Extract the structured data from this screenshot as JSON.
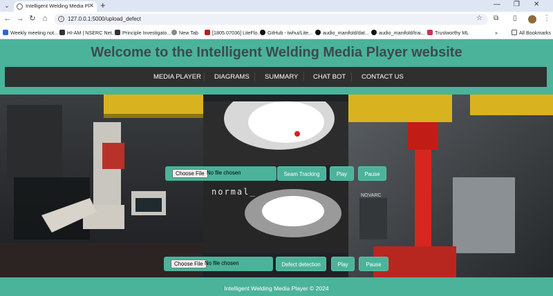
{
  "browser": {
    "tab_title": "Intelligent Welding Media Playe",
    "url": "127.0.0.1:5000/upload_defect",
    "bookmarks": [
      {
        "label": "Weekly meeting not...",
        "color": "#2b66d6"
      },
      {
        "label": "HI-AM | NSERC Net...",
        "color": "#333333"
      },
      {
        "label": "Principle Investigato...",
        "color": "#333333"
      },
      {
        "label": "New Tab",
        "color": "#888888"
      },
      {
        "label": "[1805.07036] LiteFlo...",
        "color": "#b22222"
      },
      {
        "label": "GitHub - twhui/Lite...",
        "color": "#111111"
      },
      {
        "label": "audio_manifold/dat...",
        "color": "#111111"
      },
      {
        "label": "audio_manifold/trai...",
        "color": "#111111"
      },
      {
        "label": "Trustworthy ML",
        "color": "#cc3355"
      }
    ],
    "all_bookmarks": "All Bookmarks"
  },
  "site": {
    "title": "Welcome to the Intelligent Welding Media Player website",
    "nav": [
      "MEDIA PLAYER",
      "DIAGRAMS",
      "SUMMARY",
      "CHAT BOT",
      "CONTACT US"
    ],
    "video_overlay_text": "normal_",
    "row1": {
      "choose_label": "Choose File",
      "status": "No file chosen",
      "mode": "Seam Tracking",
      "play": "Play",
      "pause": "Pause"
    },
    "row2": {
      "choose_label": "Choose File",
      "status": "No file chosen",
      "mode": "Defect detection",
      "play": "Play",
      "pause": "Pause"
    },
    "footer": "Intelligent Welding Media Player © 2024",
    "right_bg_sign": "NOVARC"
  }
}
